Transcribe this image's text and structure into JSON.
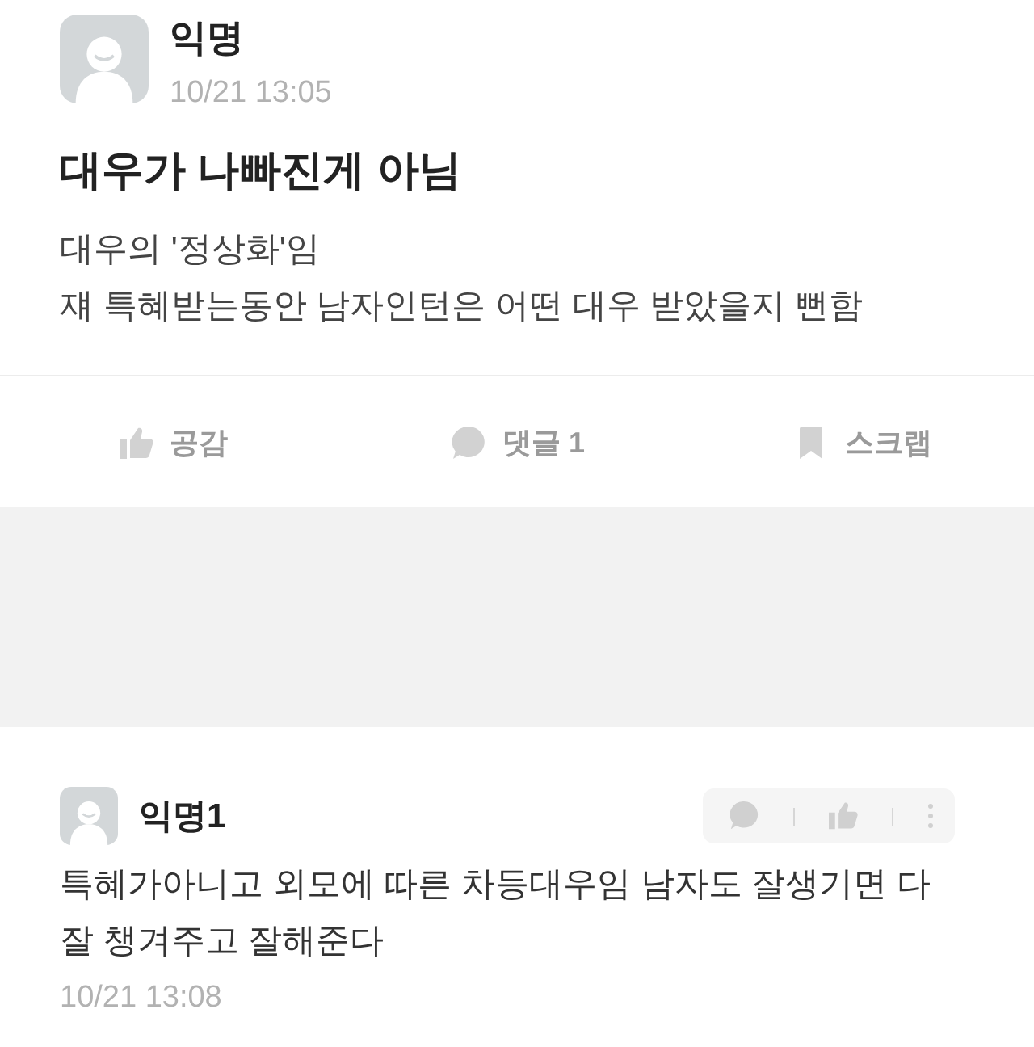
{
  "post": {
    "author": "익명",
    "time": "10/21 13:05",
    "title": "대우가 나빠진게 아님",
    "body": [
      "대우의 '정상화'임",
      "쟤 특혜받는동안 남자인턴은 어떤 대우 받았을지 뻔함"
    ],
    "actions": [
      {
        "kind": "like",
        "label": "공감"
      },
      {
        "kind": "comment",
        "label": "댓글 1"
      },
      {
        "kind": "scrap",
        "label": "스크랩"
      }
    ]
  },
  "comments": [
    {
      "author": "익명1",
      "text": "특혜가아니고 외모에 따른 차등대우임 남자도 잘생기면 다 잘 챙겨주고 잘해준다",
      "time": "10/21 13:08"
    }
  ]
}
